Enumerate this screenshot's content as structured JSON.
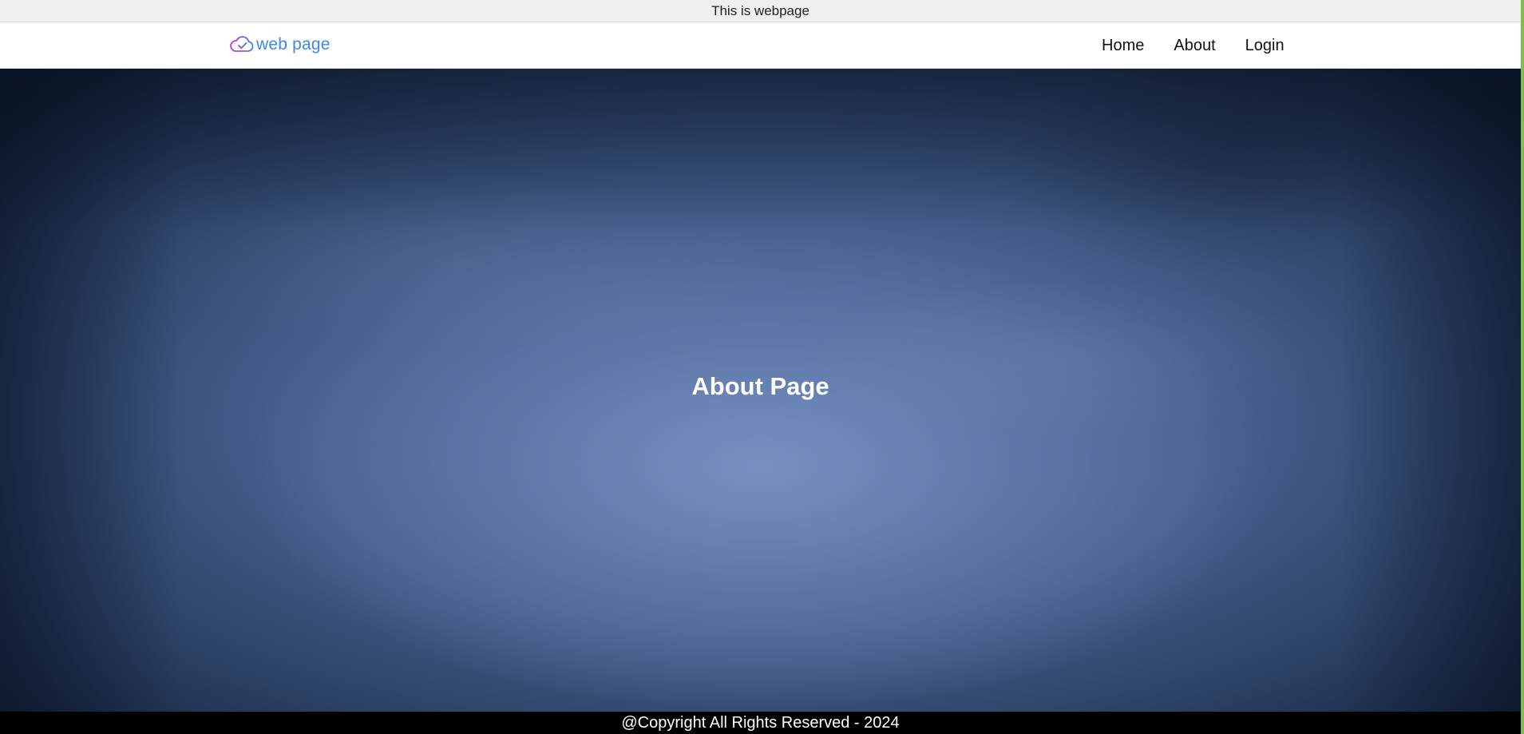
{
  "top_banner": {
    "text": "This is webpage"
  },
  "navbar": {
    "brand": {
      "label": "web page",
      "icon": "cloud-check-icon",
      "color": "#3f86e6"
    },
    "links": [
      {
        "label": "Home"
      },
      {
        "label": "About"
      },
      {
        "label": "Login"
      }
    ]
  },
  "hero": {
    "title": "About Page"
  },
  "footer": {
    "text": "@Copyright All Rights Reserved - 2024"
  },
  "colors": {
    "banner_bg": "#efefef",
    "footer_bg": "#000000",
    "hero_base": "#445e8d",
    "accent_strip": "#7dc242"
  }
}
